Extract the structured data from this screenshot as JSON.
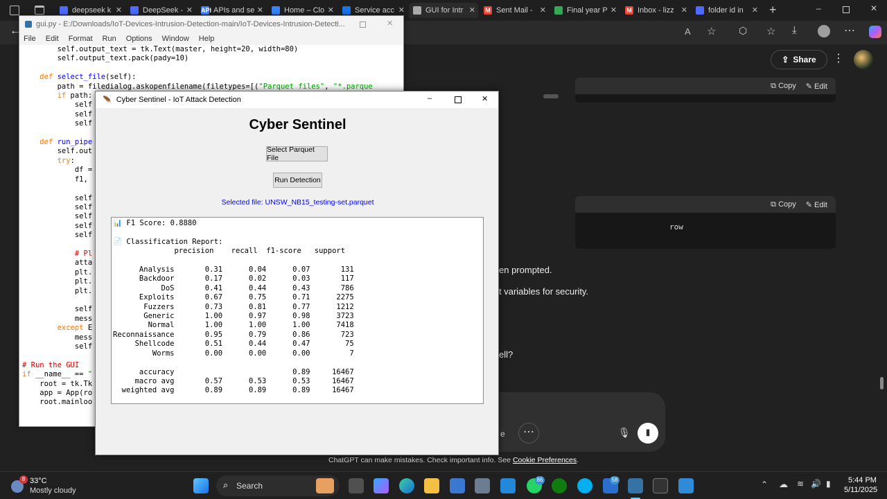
{
  "browser": {
    "tabs": [
      {
        "label": "deepseek k",
        "fav": "#4d6bfe"
      },
      {
        "label": "DeepSeek -",
        "fav": "#4d6bfe"
      },
      {
        "label": "APIs and se",
        "fav": "#4285f4",
        "favtext": "API"
      },
      {
        "label": "Home – Clo",
        "fav": "#3b82f6"
      },
      {
        "label": "Service acc",
        "fav": "#1a73e8"
      },
      {
        "label": "GUI for Intr",
        "fav": "#aaaaaa",
        "active": true
      },
      {
        "label": "Sent Mail -",
        "fav": "#ea4335",
        "favtext": "M"
      },
      {
        "label": "Final year P",
        "fav": "#34a853"
      },
      {
        "label": "Inbox - lizz",
        "fav": "#ea4335",
        "favtext": "M"
      },
      {
        "label": "folder id in",
        "fav": "#4d6bfe"
      }
    ],
    "share": "Share"
  },
  "chat": {
    "copy": "Copy",
    "edit": "Edit",
    "code_text": "row",
    "line1": "en prompted.",
    "line2": "t variables for security.",
    "line3": "ell?",
    "input_partial": "e",
    "footer": "ChatGPT can make mistakes. Check important info. See",
    "footer_link": "Cookie Preferences",
    "footer_end": "."
  },
  "idle": {
    "title": "gui.py - E:/Downloads/IoT-Devices-Intrusion-Detection-main/IoT-Devices-Intrusion-Detecti...",
    "menu": [
      "File",
      "Edit",
      "Format",
      "Run",
      "Options",
      "Window",
      "Help"
    ]
  },
  "tk": {
    "title": "Cyber Sentinel - IoT Attack Detection",
    "heading": "Cyber Sentinel",
    "select_btn": "Select Parquet File",
    "run_btn": "Run Detection",
    "selected": "Selected file: UNSW_NB15_testing-set.parquet",
    "f1": "📊 F1 Score: 0.8880",
    "report_title": "📄 Classification Report:",
    "header": "              precision    recall  f1-score   support",
    "rows": [
      "      Analysis       0.31      0.04      0.07       131",
      "      Backdoor       0.17      0.02      0.03       117",
      "           DoS       0.41      0.44      0.43       786",
      "      Exploits       0.67      0.75      0.71      2275",
      "       Fuzzers       0.73      0.81      0.77      1212",
      "       Generic       1.00      0.97      0.98      3723",
      "        Normal       1.00      1.00      1.00      7418",
      "Reconnaissance       0.95      0.79      0.86       723",
      "     Shellcode       0.51      0.44      0.47        75",
      "         Worms       0.00      0.00      0.00         7"
    ],
    "summary": [
      "      accuracy                           0.89     16467",
      "     macro avg       0.57      0.53      0.53     16467",
      "  weighted avg       0.89      0.89      0.89     16467"
    ]
  },
  "taskbar": {
    "temp": "33°C",
    "weather": "Mostly cloudy",
    "weather_badge": "8",
    "search": "Search",
    "whatsapp_badge": "86",
    "store_badge": "58",
    "time": "5:44 PM",
    "date": "5/11/2025"
  }
}
